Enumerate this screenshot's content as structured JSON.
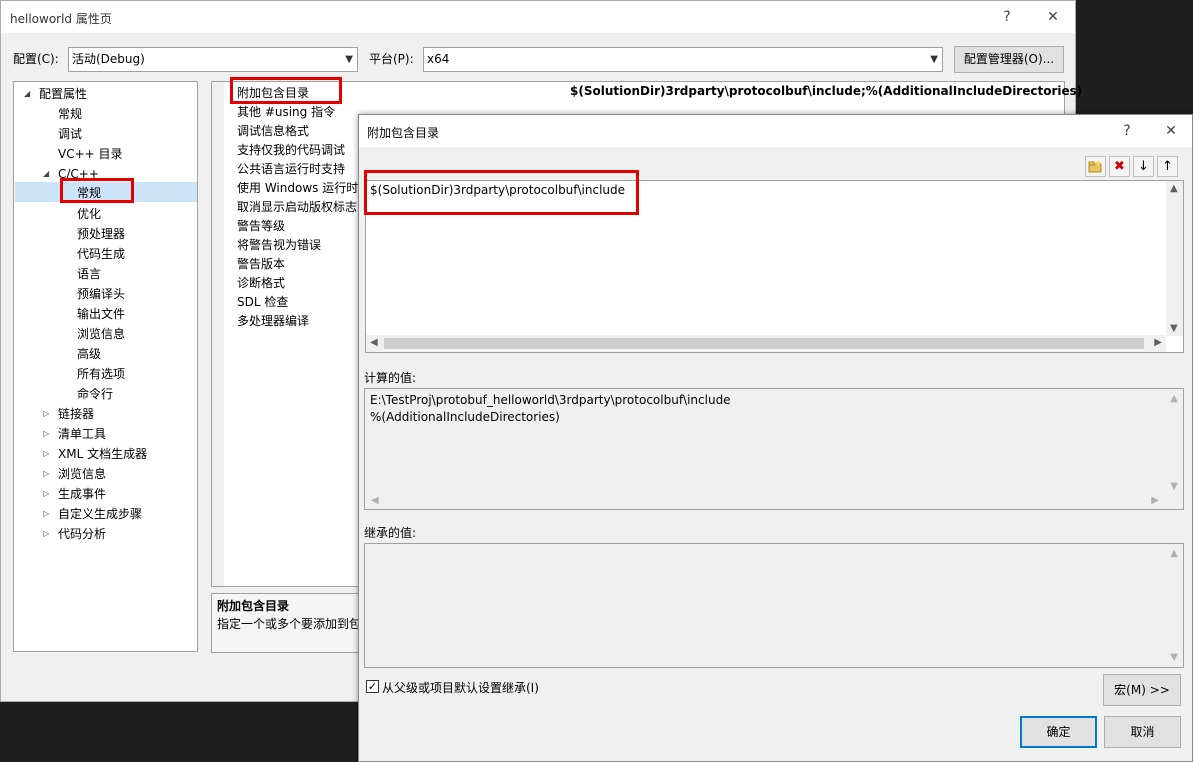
{
  "main": {
    "title": "helloworld 属性页",
    "help": "?",
    "close": "✕",
    "config_label": "配置(C):",
    "config_value": "活动(Debug)",
    "platform_label": "平台(P):",
    "platform_value": "x64",
    "config_manager": "配置管理器(O)..."
  },
  "tree": {
    "root": "配置属性",
    "items_l1": [
      "常规",
      "调试",
      "VC++ 目录"
    ],
    "cpp": "C/C++",
    "cpp_children": [
      "常规",
      "优化",
      "预处理器",
      "代码生成",
      "语言",
      "预编译头",
      "输出文件",
      "浏览信息",
      "高级",
      "所有选项",
      "命令行"
    ],
    "after": [
      "链接器",
      "清单工具",
      "XML 文档生成器",
      "浏览信息",
      "生成事件",
      "自定义生成步骤",
      "代码分析"
    ]
  },
  "grid": {
    "items": [
      "附加包含目录",
      "其他 #using 指令",
      "调试信息格式",
      "支持仅我的代码调试",
      "公共语言运行时支持",
      "使用 Windows 运行时",
      "取消显示启动版权标志",
      "警告等级",
      "将警告视为错误",
      "警告版本",
      "诊断格式",
      "SDL 检查",
      "多处理器编译"
    ],
    "first_value": "$(SolutionDir)3rdparty\\protocolbuf\\include;%(AdditionalIncludeDirectories)",
    "desc_title": "附加包含目录",
    "desc_text": "指定一个或多个要添加到包"
  },
  "dialog": {
    "title": "附加包含目录",
    "help": "?",
    "close": "✕",
    "edit_line": "$(SolutionDir)3rdparty\\protocolbuf\\include",
    "computed_label": "计算的值:",
    "computed_lines": [
      "E:\\TestProj\\protobuf_helloworld\\3rdparty\\protocolbuf\\include",
      "%(AdditionalIncludeDirectories)"
    ],
    "inherited_label": "继承的值:",
    "inherit_checkbox": "从父级或项目默认设置继承(I)",
    "macro_button": "宏(M) >>",
    "ok": "确定",
    "cancel": "取消",
    "toolbar_icons": [
      "new-folder-icon",
      "delete-icon",
      "move-down-icon",
      "move-up-icon"
    ]
  },
  "colors": {
    "highlight": "#e30000",
    "selection": "#cce4f7",
    "default_button_border": "#0078d7"
  }
}
